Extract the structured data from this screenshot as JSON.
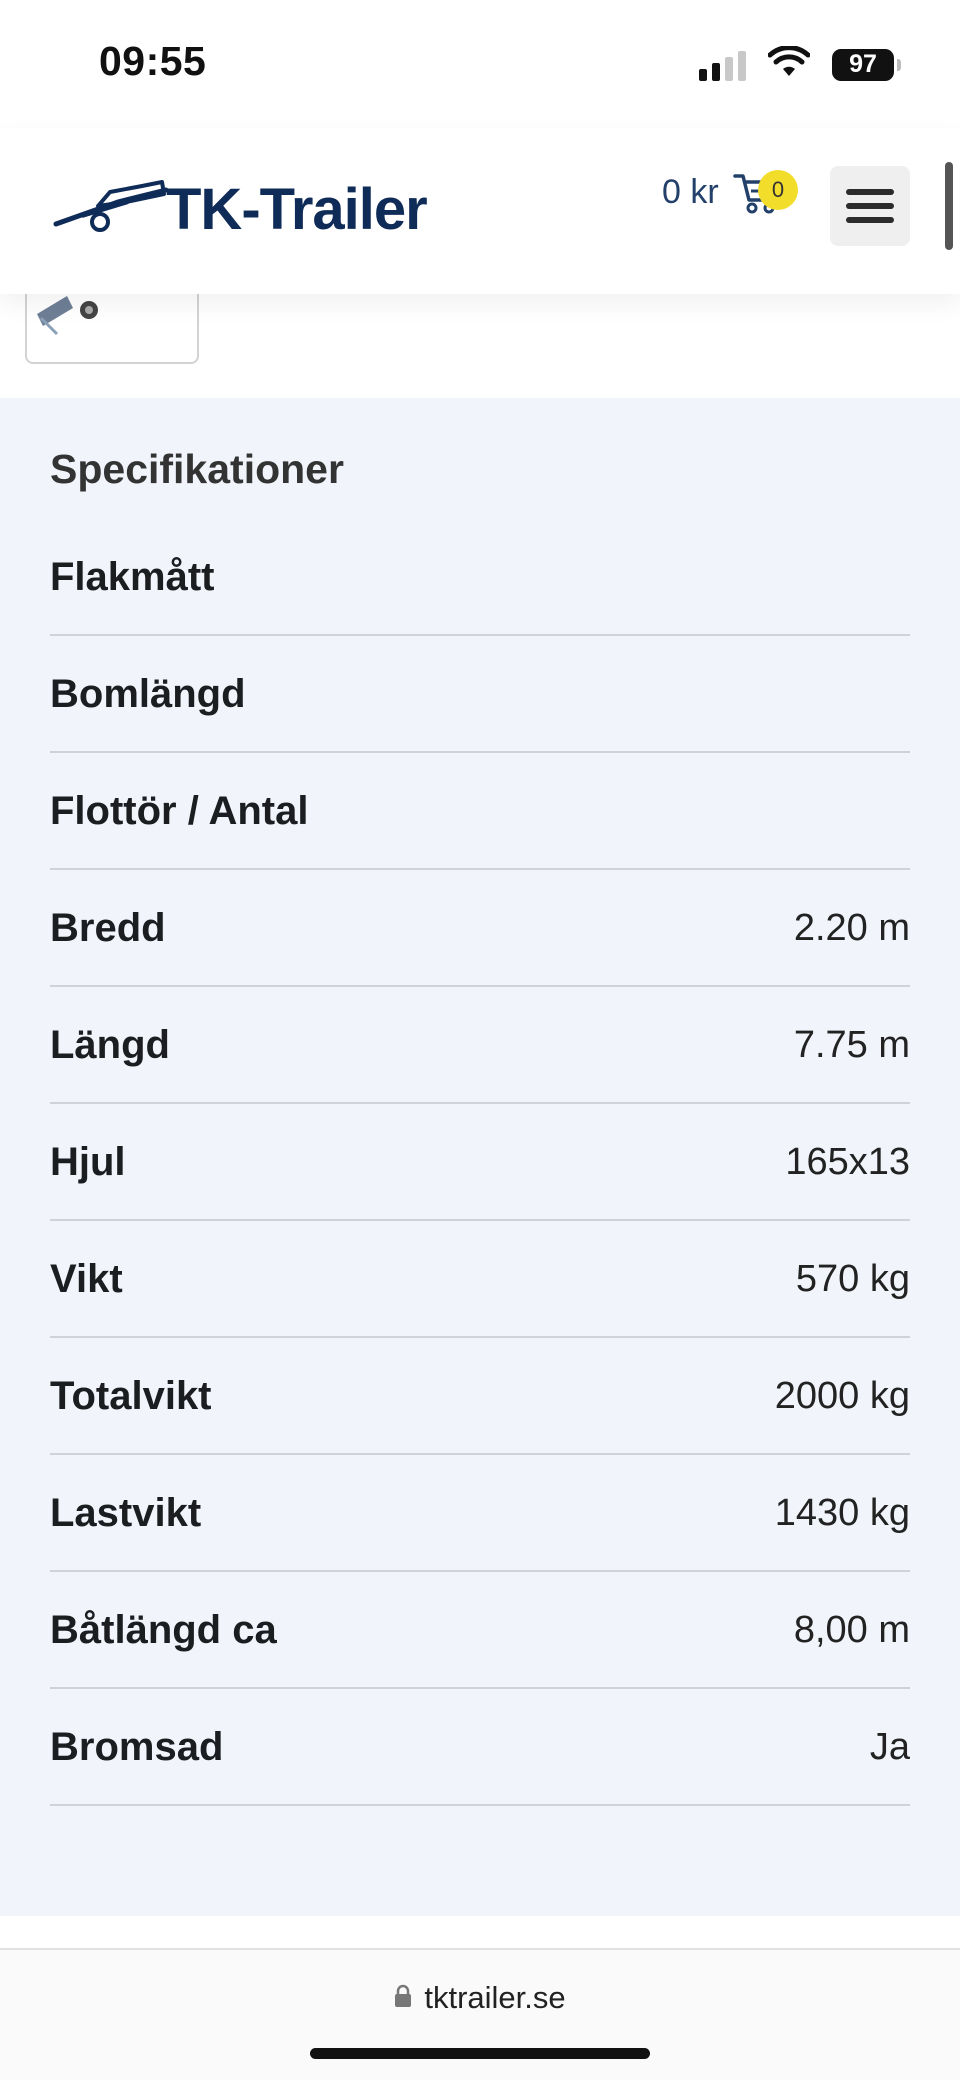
{
  "status_bar": {
    "time": "09:55",
    "battery": "97"
  },
  "header": {
    "logo_text": "TK-Trailer",
    "cart_amount": "0 kr",
    "cart_count": "0"
  },
  "specifications": {
    "title": "Specifikationer",
    "rows": [
      {
        "label": "Flakmått",
        "value": ""
      },
      {
        "label": "Bomlängd",
        "value": ""
      },
      {
        "label": "Flottör / Antal",
        "value": ""
      },
      {
        "label": "Bredd",
        "value": "2.20 m"
      },
      {
        "label": "Längd",
        "value": "7.75 m"
      },
      {
        "label": "Hjul",
        "value": "165x13"
      },
      {
        "label": "Vikt",
        "value": "570 kg"
      },
      {
        "label": "Totalvikt",
        "value": "2000 kg"
      },
      {
        "label": "Lastvikt",
        "value": "1430 kg"
      },
      {
        "label": "Båtlängd ca",
        "value": "8,00 m"
      },
      {
        "label": "Bromsad",
        "value": "Ja"
      }
    ]
  },
  "browser": {
    "url": "tktrailer.se"
  },
  "colors": {
    "brand_navy": "#0f2b57",
    "badge_yellow": "#f2dd2b",
    "section_bg": "#f1f5fb"
  },
  "icons": [
    "signal-icon",
    "wifi-icon",
    "battery-icon",
    "trailer-logo-icon",
    "cart-icon",
    "hamburger-menu-icon",
    "lock-icon"
  ]
}
